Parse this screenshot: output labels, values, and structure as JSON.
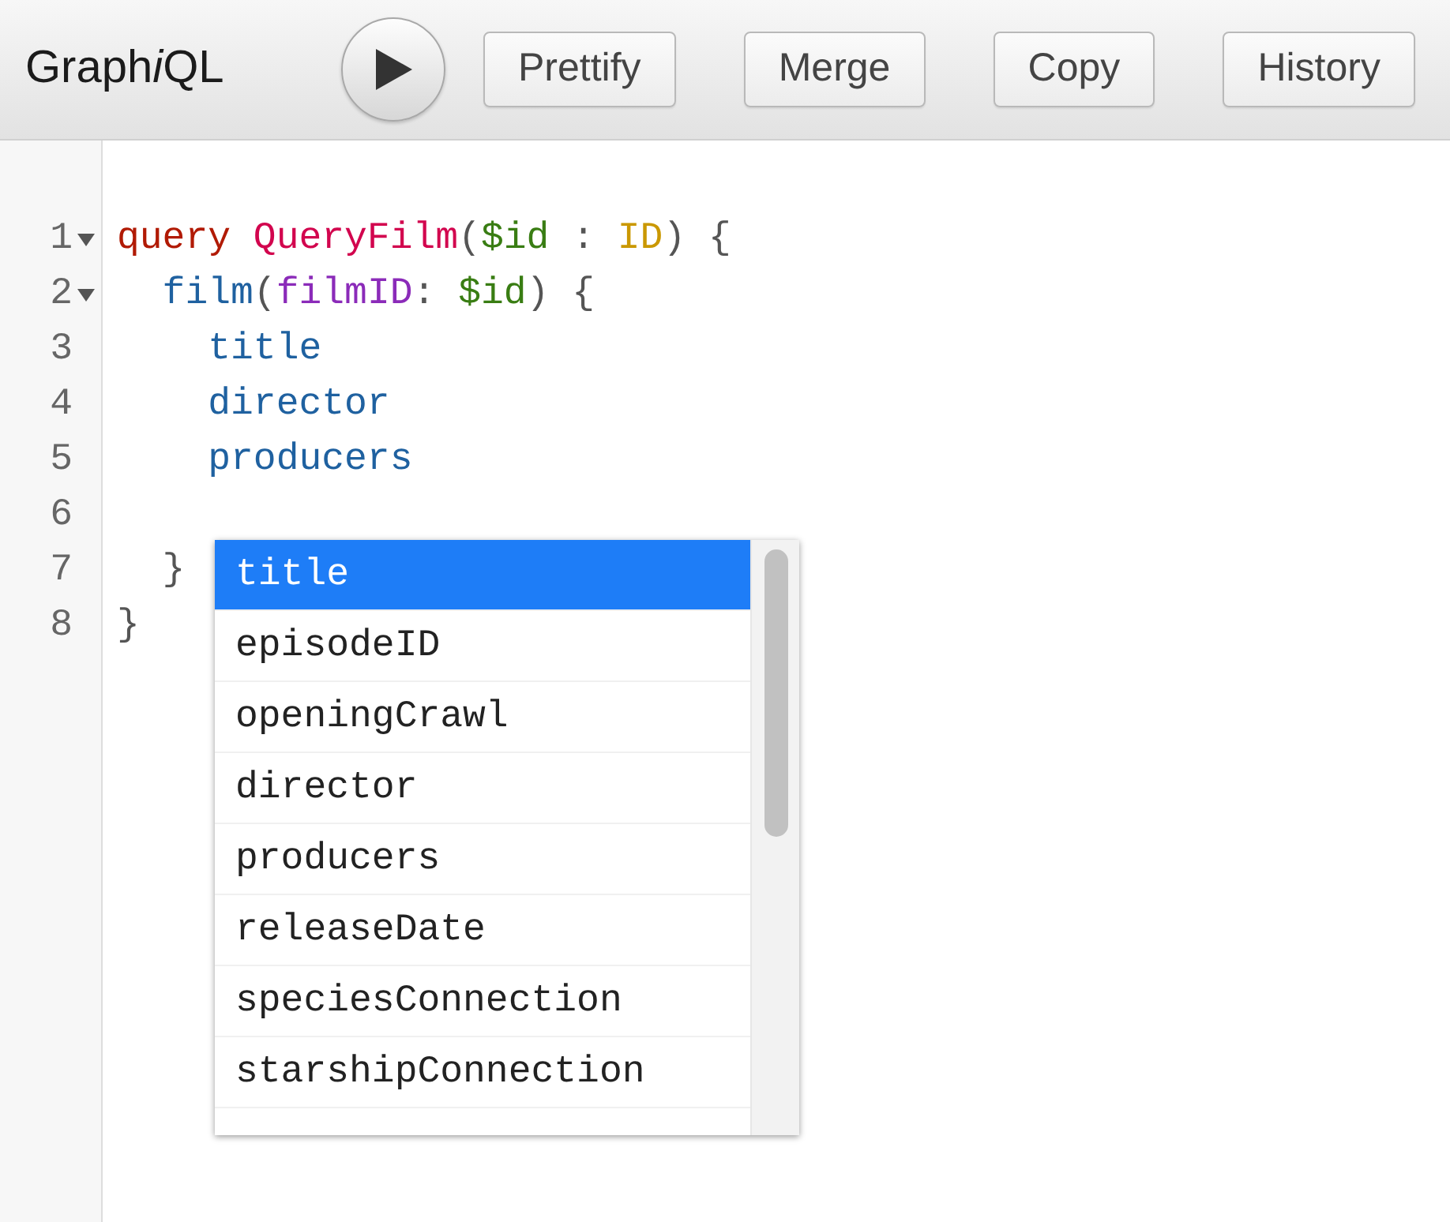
{
  "toolbar": {
    "logo": "Graph",
    "logo_italic": "i",
    "logo_end": "QL",
    "buttons": [
      "Prettify",
      "Merge",
      "Copy",
      "History"
    ]
  },
  "editor": {
    "lines": [
      {
        "number": "1",
        "fold_marker": true,
        "tokens": [
          {
            "kind": "keyword",
            "text": "query "
          },
          {
            "kind": "def",
            "text": "QueryFilm"
          },
          {
            "kind": "punct",
            "text": "("
          },
          {
            "kind": "variable",
            "text": "$id"
          },
          {
            "kind": "punct",
            "text": " : "
          },
          {
            "kind": "type",
            "text": "ID"
          },
          {
            "kind": "punct",
            "text": ") {"
          }
        ]
      },
      {
        "number": "2",
        "fold_marker": true,
        "tokens": [
          {
            "kind": "property",
            "text": "  film"
          },
          {
            "kind": "punct",
            "text": "("
          },
          {
            "kind": "attribute",
            "text": "filmID"
          },
          {
            "kind": "punct",
            "text": ": "
          },
          {
            "kind": "variable",
            "text": "$id"
          },
          {
            "kind": "punct",
            "text": ") {"
          }
        ]
      },
      {
        "number": "3",
        "fold_marker": false,
        "tokens": [
          {
            "kind": "property",
            "text": "    title"
          }
        ]
      },
      {
        "number": "4",
        "fold_marker": false,
        "tokens": [
          {
            "kind": "property",
            "text": "    director"
          }
        ]
      },
      {
        "number": "5",
        "fold_marker": false,
        "tokens": [
          {
            "kind": "property",
            "text": "    producers"
          }
        ]
      },
      {
        "number": "6",
        "fold_marker": false
      },
      {
        "number": "7",
        "fold_marker": false,
        "tokens": [
          {
            "kind": "punct",
            "text": "  }"
          }
        ]
      },
      {
        "number": "8",
        "fold_marker": false,
        "tokens": [
          {
            "kind": "punct",
            "text": "}"
          }
        ]
      }
    ]
  },
  "autocomplete": {
    "items": [
      {
        "label": "title",
        "selected": true
      },
      {
        "label": "episodeID",
        "selected": false
      },
      {
        "label": "openingCrawl",
        "selected": false
      },
      {
        "label": "director",
        "selected": false
      },
      {
        "label": "producers",
        "selected": false
      },
      {
        "label": "releaseDate",
        "selected": false
      },
      {
        "label": "speciesConnection",
        "selected": false
      },
      {
        "label": "starshipConnection",
        "selected": false
      }
    ]
  }
}
